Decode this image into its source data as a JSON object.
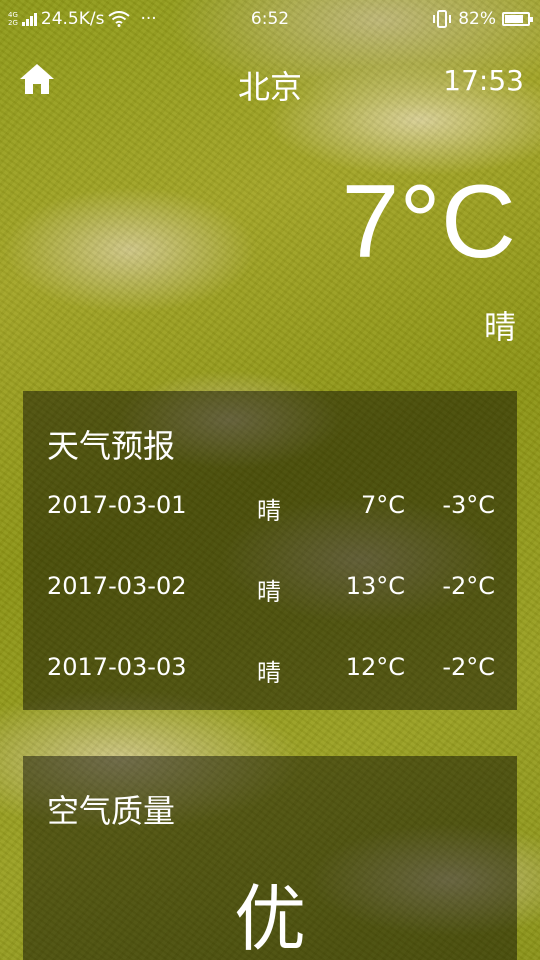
{
  "status_bar": {
    "network": "4G 2G",
    "speed": "24.5K/s",
    "dots": "···",
    "time": "6:52",
    "battery": "82%",
    "battery_level": 0.82
  },
  "header": {
    "city": "北京",
    "update_time": "17:53"
  },
  "now": {
    "temperature": "7°C",
    "info": "晴"
  },
  "forecast": {
    "title": "天气预报",
    "items": [
      {
        "date": "2017-03-01",
        "info": "晴",
        "max": "7°C",
        "min": "-3°C"
      },
      {
        "date": "2017-03-02",
        "info": "晴",
        "max": "13°C",
        "min": "-2°C"
      },
      {
        "date": "2017-03-03",
        "info": "晴",
        "max": "12°C",
        "min": "-2°C"
      }
    ]
  },
  "aqi": {
    "title": "空气质量",
    "quality": "优"
  },
  "icons": {
    "home": "home-icon",
    "wifi": "wifi-icon",
    "signal": "signal-icon",
    "battery": "battery-icon",
    "vibrate": "vibrate-icon"
  }
}
